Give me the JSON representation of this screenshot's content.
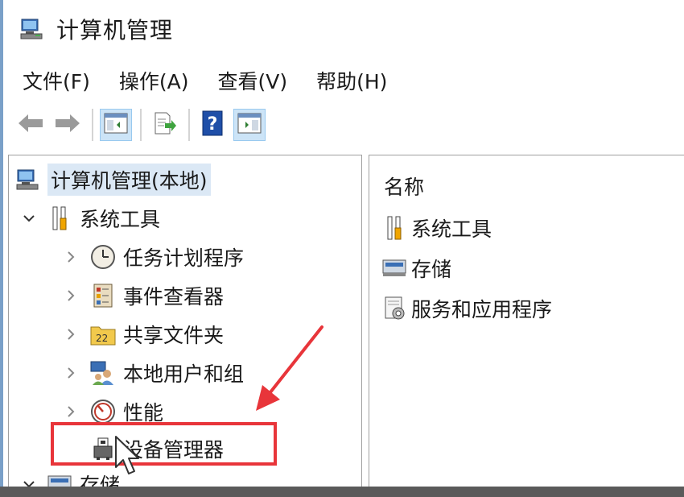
{
  "window": {
    "title": "计算机管理"
  },
  "menu": [
    {
      "label": "文件(F)"
    },
    {
      "label": "操作(A)"
    },
    {
      "label": "查看(V)"
    },
    {
      "label": "帮助(H)"
    }
  ],
  "toolbar": {
    "buttons": [
      "back-arrow-icon",
      "forward-arrow-icon",
      "show-hide-tree-icon",
      "export-list-icon",
      "help-icon",
      "show-hide-action-pane-icon"
    ]
  },
  "tree": {
    "root": "计算机管理(本地)",
    "system_tools": "系统工具",
    "task_scheduler": "任务计划程序",
    "event_viewer": "事件查看器",
    "shared_folders": "共享文件夹",
    "local_users": "本地用户和组",
    "performance": "性能",
    "device_manager": "设备管理器",
    "storage": "存储"
  },
  "details": {
    "column_name": "名称",
    "items": [
      {
        "label": "系统工具"
      },
      {
        "label": "存储"
      },
      {
        "label": "服务和应用程序"
      }
    ]
  },
  "annotation": {
    "color": "#e8353a"
  }
}
